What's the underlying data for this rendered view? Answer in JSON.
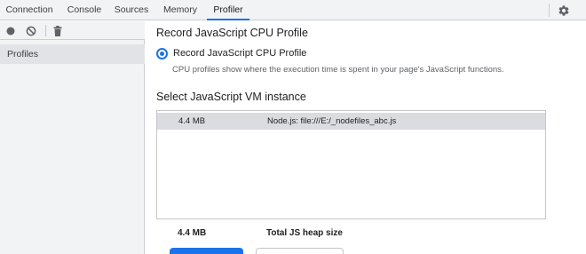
{
  "tabs": [
    {
      "label": "Connection",
      "active": false
    },
    {
      "label": "Console",
      "active": false
    },
    {
      "label": "Sources",
      "active": false
    },
    {
      "label": "Memory",
      "active": false
    },
    {
      "label": "Profiler",
      "active": true
    }
  ],
  "toolbar": {
    "record_icon": "record-icon",
    "clear_icon": "clear-icon",
    "delete_icon": "trash-icon"
  },
  "sidebar": {
    "items": [
      {
        "label": "Profiles"
      }
    ]
  },
  "main": {
    "heading": "Record JavaScript CPU Profile",
    "radio_label": "Record JavaScript CPU Profile",
    "radio_description": "CPU profiles show where the execution time is spent in your page's JavaScript functions.",
    "vm_heading": "Select JavaScript VM instance",
    "vm_instances": [
      {
        "size": "4.4 MB",
        "name": "Node.js: file:///E:/_nodefiles_abc.js",
        "selected": true
      }
    ],
    "summary": {
      "size": "4.4 MB",
      "label": "Total JS heap size"
    }
  },
  "colors": {
    "accent": "#1a73e8",
    "selected_row": "#dadce0",
    "sidebar_bg": "#f1f3f4"
  }
}
